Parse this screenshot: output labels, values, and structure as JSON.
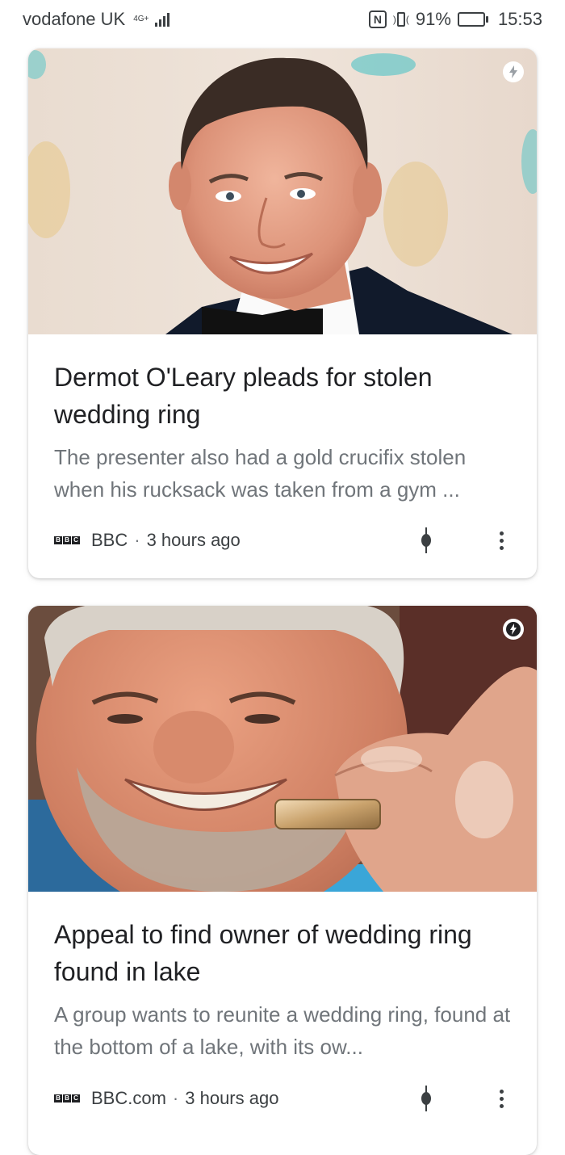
{
  "status_bar": {
    "carrier": "vodafone UK",
    "network": "4G+",
    "nfc": "N",
    "battery_percent": "91%",
    "battery_level": 0.91,
    "time": "15:53"
  },
  "articles": [
    {
      "headline": "Dermot O'Leary pleads for stolen wedding ring",
      "snippet": "The presenter also had a gold crucifix stolen when his rucksack was taken from a gym ...",
      "source_logo": "BBC",
      "source": "BBC",
      "time": "3 hours ago",
      "amp": true
    },
    {
      "headline": "Appeal to find owner of wedding ring found in lake",
      "snippet": "A group wants to reunite a wedding ring, found at the bottom of a lake, with its ow...",
      "source_logo": "BBC",
      "source": "BBC.com",
      "time": "3 hours ago",
      "amp": true
    }
  ],
  "colors": {
    "headline": "#202124",
    "snippet": "#70757a",
    "meta": "#3c4043"
  }
}
